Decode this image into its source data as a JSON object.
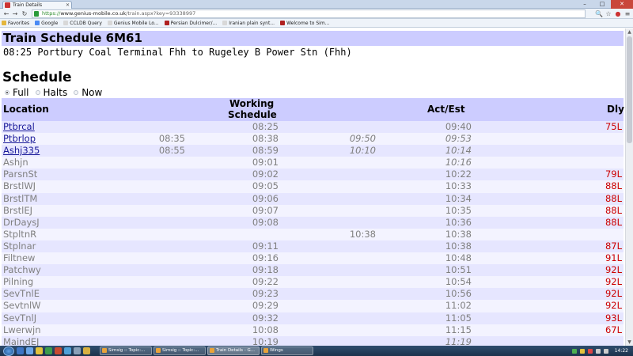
{
  "browser": {
    "tab_title": "Train Details",
    "url_scheme": "https://",
    "url_host": "www.genius-mobile.co.uk",
    "url_path": "/train.aspx?key=93338997",
    "window_controls": [
      "–",
      "□",
      "✕"
    ],
    "bookmarks": [
      {
        "label": "Favorites",
        "color": "#e4b63c"
      },
      {
        "label": "Google",
        "color": "#4a8af4"
      },
      {
        "label": "CCLDB Query",
        "color": "#d8d8d8"
      },
      {
        "label": "Genius Mobile Lo...",
        "color": "#d8d8d8"
      },
      {
        "label": "Persian Dulcimer/...",
        "color": "#b02020"
      },
      {
        "label": "Iranian plain synt...",
        "color": "#d8d8d8"
      },
      {
        "label": "Welcome to Sim...",
        "color": "#b02020"
      }
    ]
  },
  "page": {
    "title": "Train Schedule 6M61",
    "route": "08:25 Portbury Coal Terminal Fhh to Rugeley B Power Stn (Fhh)",
    "schedule_heading": "Schedule",
    "view_options": [
      {
        "label": "Full",
        "selected": true
      },
      {
        "label": "Halts",
        "selected": false
      },
      {
        "label": "Now",
        "selected": false
      }
    ],
    "table": {
      "headers": {
        "location": "Location",
        "working_schedule_line1": "Working",
        "working_schedule_line2": "Schedule",
        "act_est": "Act/Est",
        "dly": "Dly"
      },
      "rows": [
        {
          "location": "Ptbrcal",
          "link": true,
          "arr": "",
          "ws": "08:25",
          "act_arr": "",
          "act_dep": "09:40",
          "est": false,
          "dly": "75L"
        },
        {
          "location": "Ptbrlop",
          "link": true,
          "arr": "08:35",
          "ws": "08:38",
          "act_arr": "09:50",
          "act_dep": "09:53",
          "est": true,
          "dly": ""
        },
        {
          "location": "Ashj335",
          "link": true,
          "arr": "08:55",
          "ws": "08:59",
          "act_arr": "10:10",
          "act_dep": "10:14",
          "est": true,
          "dly": ""
        },
        {
          "location": "Ashjn",
          "link": false,
          "arr": "",
          "ws": "09:01",
          "act_arr": "",
          "act_dep": "10:16",
          "est": true,
          "dly": ""
        },
        {
          "location": "ParsnSt",
          "link": false,
          "arr": "",
          "ws": "09:02",
          "act_arr": "",
          "act_dep": "10:22",
          "est": false,
          "dly": "79L"
        },
        {
          "location": "BrstlWJ",
          "link": false,
          "arr": "",
          "ws": "09:05",
          "act_arr": "",
          "act_dep": "10:33",
          "est": false,
          "dly": "88L"
        },
        {
          "location": "BrstlTM",
          "link": false,
          "arr": "",
          "ws": "09:06",
          "act_arr": "",
          "act_dep": "10:34",
          "est": false,
          "dly": "88L"
        },
        {
          "location": "BrstlEJ",
          "link": false,
          "arr": "",
          "ws": "09:07",
          "act_arr": "",
          "act_dep": "10:35",
          "est": false,
          "dly": "88L"
        },
        {
          "location": "DrDaysJ",
          "link": false,
          "arr": "",
          "ws": "09:08",
          "act_arr": "",
          "act_dep": "10:36",
          "est": false,
          "dly": "88L"
        },
        {
          "location": "StpltnR",
          "link": false,
          "arr": "",
          "ws": "",
          "act_arr": "10:38",
          "act_dep": "10:38",
          "est": false,
          "dly": "",
          "arr_plain": true
        },
        {
          "location": "Stplnar",
          "link": false,
          "arr": "",
          "ws": "09:11",
          "act_arr": "",
          "act_dep": "10:38",
          "est": false,
          "dly": "87L"
        },
        {
          "location": "Filtnew",
          "link": false,
          "arr": "",
          "ws": "09:16",
          "act_arr": "",
          "act_dep": "10:48",
          "est": false,
          "dly": "91L"
        },
        {
          "location": "Patchwy",
          "link": false,
          "arr": "",
          "ws": "09:18",
          "act_arr": "",
          "act_dep": "10:51",
          "est": false,
          "dly": "92L"
        },
        {
          "location": "Pilning",
          "link": false,
          "arr": "",
          "ws": "09:22",
          "act_arr": "",
          "act_dep": "10:54",
          "est": false,
          "dly": "92L"
        },
        {
          "location": "SevTnlE",
          "link": false,
          "arr": "",
          "ws": "09:23",
          "act_arr": "",
          "act_dep": "10:56",
          "est": false,
          "dly": "92L"
        },
        {
          "location": "SevtnlW",
          "link": false,
          "arr": "",
          "ws": "09:29",
          "act_arr": "",
          "act_dep": "11:02",
          "est": false,
          "dly": "92L"
        },
        {
          "location": "SevTnlJ",
          "link": false,
          "arr": "",
          "ws": "09:32",
          "act_arr": "",
          "act_dep": "11:05",
          "est": false,
          "dly": "93L"
        },
        {
          "location": "Lwerwjn",
          "link": false,
          "arr": "",
          "ws": "10:08",
          "act_arr": "",
          "act_dep": "11:15",
          "est": false,
          "dly": "67L"
        },
        {
          "location": "MaindEJ",
          "link": false,
          "arr": "",
          "ws": "10:19",
          "act_arr": "",
          "act_dep": "11:19",
          "est": true,
          "dly": ""
        }
      ]
    }
  },
  "taskbar": {
    "tasks": [
      {
        "label": "Simsig :: Topic:...",
        "active": false
      },
      {
        "label": "Simsig :: Topic:...",
        "active": false
      },
      {
        "label": "Train Details - G...",
        "active": true
      },
      {
        "label": "Wings",
        "active": false
      }
    ],
    "clock": "14:22"
  }
}
